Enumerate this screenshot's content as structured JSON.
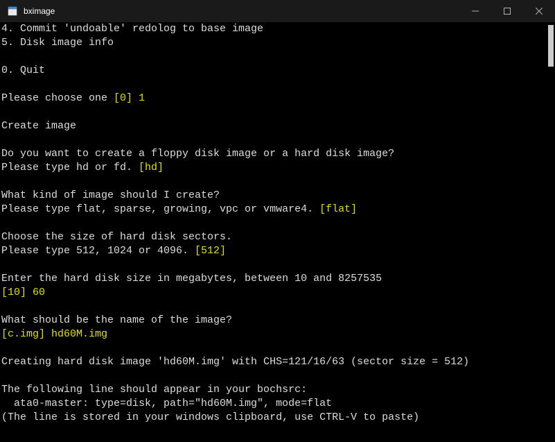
{
  "window": {
    "title": "bximage"
  },
  "terminal": {
    "lines": [
      {
        "segments": [
          {
            "t": "4. Commit 'undoable' redolog to base image",
            "c": "w"
          }
        ]
      },
      {
        "segments": [
          {
            "t": "5. Disk image info",
            "c": "w"
          }
        ]
      },
      {
        "segments": []
      },
      {
        "segments": [
          {
            "t": "0. Quit",
            "c": "w"
          }
        ]
      },
      {
        "segments": []
      },
      {
        "segments": [
          {
            "t": "Please choose one ",
            "c": "w"
          },
          {
            "t": "[0]",
            "c": "y"
          },
          {
            "t": " ",
            "c": "w"
          },
          {
            "t": "1",
            "c": "y"
          }
        ]
      },
      {
        "segments": []
      },
      {
        "segments": [
          {
            "t": "Create image",
            "c": "w"
          }
        ]
      },
      {
        "segments": []
      },
      {
        "segments": [
          {
            "t": "Do you want to create a floppy disk image or a hard disk image?",
            "c": "w"
          }
        ]
      },
      {
        "segments": [
          {
            "t": "Please type hd or fd. ",
            "c": "w"
          },
          {
            "t": "[hd]",
            "c": "y"
          }
        ]
      },
      {
        "segments": []
      },
      {
        "segments": [
          {
            "t": "What kind of image should I create?",
            "c": "w"
          }
        ]
      },
      {
        "segments": [
          {
            "t": "Please type flat, sparse, growing, vpc or vmware4. ",
            "c": "w"
          },
          {
            "t": "[flat]",
            "c": "y"
          }
        ]
      },
      {
        "segments": []
      },
      {
        "segments": [
          {
            "t": "Choose the size of hard disk sectors.",
            "c": "w"
          }
        ]
      },
      {
        "segments": [
          {
            "t": "Please type 512, 1024 or 4096. ",
            "c": "w"
          },
          {
            "t": "[512]",
            "c": "y"
          }
        ]
      },
      {
        "segments": []
      },
      {
        "segments": [
          {
            "t": "Enter the hard disk size in megabytes, between 10 and 8257535",
            "c": "w"
          }
        ]
      },
      {
        "segments": [
          {
            "t": "[10]",
            "c": "y"
          },
          {
            "t": " ",
            "c": "w"
          },
          {
            "t": "60",
            "c": "y"
          }
        ]
      },
      {
        "segments": []
      },
      {
        "segments": [
          {
            "t": "What should be the name of the image?",
            "c": "w"
          }
        ]
      },
      {
        "segments": [
          {
            "t": "[c.img]",
            "c": "y"
          },
          {
            "t": " ",
            "c": "w"
          },
          {
            "t": "hd60M.img",
            "c": "y"
          }
        ]
      },
      {
        "segments": []
      },
      {
        "segments": [
          {
            "t": "Creating hard disk image 'hd60M.img' with CHS=121/16/63 (sector size = 512)",
            "c": "w"
          }
        ]
      },
      {
        "segments": []
      },
      {
        "segments": [
          {
            "t": "The following line should appear in your bochsrc:",
            "c": "w"
          }
        ]
      },
      {
        "segments": [
          {
            "t": "  ata0-master: type=disk, path=\"hd60M.img\", mode=flat",
            "c": "w"
          }
        ]
      },
      {
        "segments": [
          {
            "t": "(The line is stored in your windows clipboard, use CTRL-V to paste)",
            "c": "w"
          }
        ]
      }
    ]
  }
}
